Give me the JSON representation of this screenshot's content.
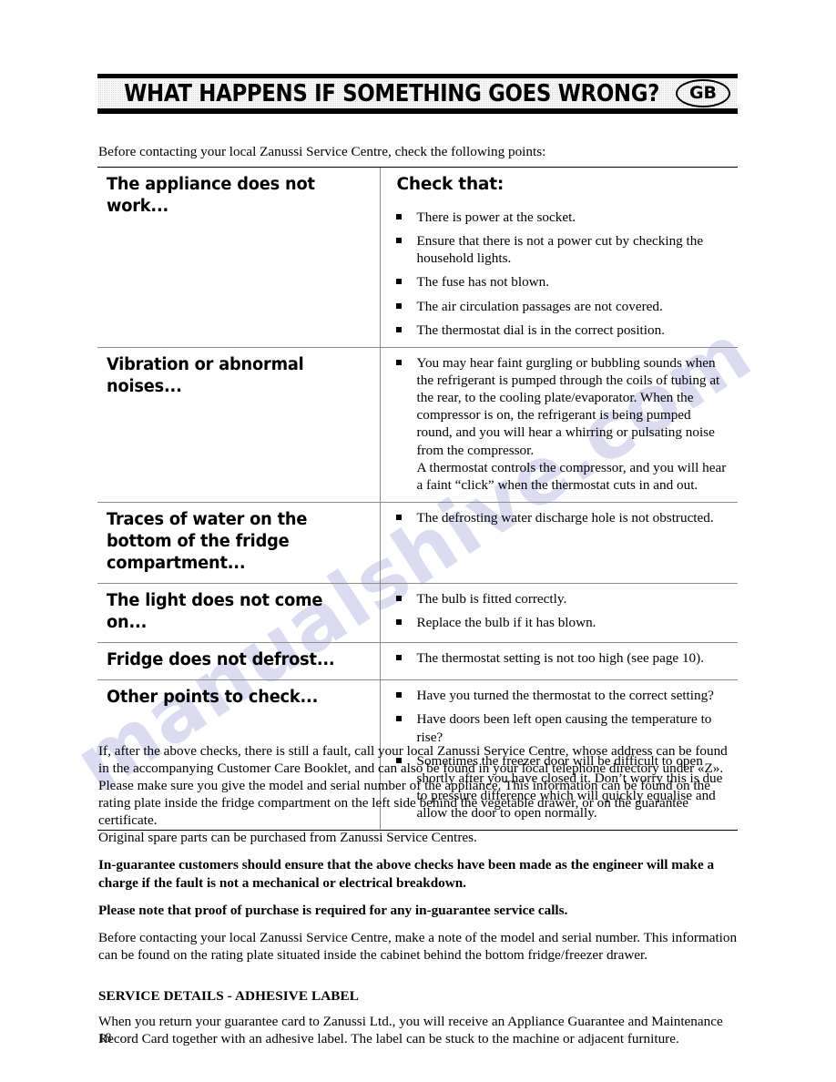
{
  "banner": {
    "title": "WHAT HAPPENS IF SOMETHING GOES WRONG?",
    "region_badge": "GB"
  },
  "intro": "Before contacting your local Zanussi Service Centre, check the following points:",
  "table": {
    "columns": [
      "The appliance does not work...",
      "Check that:"
    ],
    "rows": [
      {
        "fault": "The appliance does not work...",
        "check_heading": "Check that:",
        "items": [
          "There is power at the socket.",
          "Ensure that there is not a power cut by checking the household lights.",
          "The fuse has not blown.",
          "The air circulation passages are not covered.",
          "The thermostat dial is in the correct position."
        ]
      },
      {
        "fault": "Vibration or abnormal noises...",
        "items": [
          "You may hear faint gurgling or bubbling sounds when the refrigerant is pumped through the coils of tubing at the rear, to the cooling plate/evaporator. When the compressor is on, the refrigerant is being pumped round, and you will hear a whirring or pulsating noise from the compressor."
        ],
        "item_continuations": [
          "A thermostat controls the compressor, and you will hear a faint “click” when the thermostat cuts in and out."
        ]
      },
      {
        "fault": "Traces of water on the bottom of the fridge compartment...",
        "items": [
          "The defrosting water discharge hole is not obstructed."
        ]
      },
      {
        "fault": "The light does not come on...",
        "items": [
          "The bulb is fitted correctly.",
          "Replace the bulb if it has blown."
        ]
      },
      {
        "fault": "Fridge does not defrost...",
        "items": [
          "The thermostat setting is not too high (see page 10)."
        ]
      },
      {
        "fault": "Other points to check...",
        "items": [
          "Have you turned the thermostat to the correct setting?",
          "Have doors been left open causing the temperature to rise?",
          "Sometimes the freezer door will be difficult to open shortly after you have closed it. Don’t worry this is due to pressure difference which will quickly equalise and allow the door to open normally."
        ]
      }
    ]
  },
  "bottom": {
    "para1": "If, after the above checks, there is still a fault, call your local Zanussi Service Centre, whose address can be found in the accompanying Customer Care Booklet, and can also be found in your local telephone directory under «Z». Please make sure you give the model and serial number of the appliance. This information can be found on the rating plate inside the fridge compartment on the left side behind the vegetable drawer, or on the guarantee certificate.",
    "para2": "Original spare parts can be purchased from Zanussi Service Centres.",
    "para3_bold": "In-guarantee customers should ensure that the above checks have been made as the engineer will make a charge if the fault is not a mechanical or electrical breakdown.",
    "para4_bold": "Please note that proof of purchase is required for any in-guarantee service calls.",
    "para5": "Before contacting your local Zanussi Service Centre, make a note of the model and serial number. This information can be found on the rating plate situated inside the cabinet behind the bottom fridge/freezer drawer.",
    "service_heading": "SERVICE DETAILS - ADHESIVE LABEL",
    "service_body": "When you return your guarantee card to Zanussi Ltd., you will receive an Appliance Guarantee and Maintenance Record Card together with an adhesive label. The label can be stuck to the machine or adjacent furniture."
  },
  "page_number": "18",
  "watermark": {
    "text": "manualshive.com",
    "color": "#bfbfe8"
  }
}
